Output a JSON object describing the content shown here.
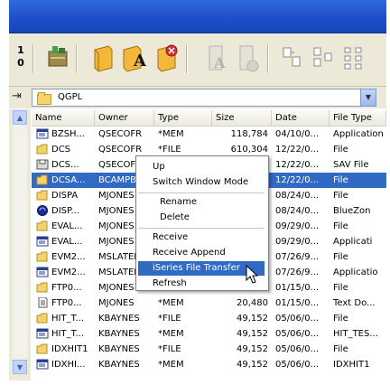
{
  "toolbar": {
    "left_number_top": "1",
    "left_number_bottom": "0"
  },
  "address": {
    "library": "QGPL"
  },
  "columns": [
    "Name",
    "Owner",
    "Type",
    "Size",
    "Date",
    "File Type"
  ],
  "rows": [
    {
      "icon": "member-icon",
      "name": "BZSH...",
      "owner": "QSECOFR",
      "type": "*MEM",
      "size": "118,784",
      "date": "04/10/0...",
      "filetype": "Application"
    },
    {
      "icon": "folder-icon",
      "name": "DCS",
      "owner": "QSECOFR",
      "type": "*FILE",
      "size": "610,304",
      "date": "12/22/0...",
      "filetype": "File"
    },
    {
      "icon": "save-file-icon",
      "name": "DCS...",
      "owner": "QSECOFR",
      "type": "",
      "size": "",
      "date": "12/22/0...",
      "filetype": "SAV File"
    },
    {
      "icon": "folder-icon",
      "name": "DCSA...",
      "owner": "BCAMPB",
      "type": "",
      "size": "",
      "date": "12/22/0...",
      "filetype": "File"
    },
    {
      "icon": "folder-icon",
      "name": "DISPA",
      "owner": "MJONES",
      "type": "",
      "size": "",
      "date": "08/24/0...",
      "filetype": "File"
    },
    {
      "icon": "bluezone-icon",
      "name": "DISP...",
      "owner": "MJONES",
      "type": "",
      "size": "",
      "date": "08/24/0...",
      "filetype": "BlueZon"
    },
    {
      "icon": "folder-icon",
      "name": "EVAL...",
      "owner": "MJONES",
      "type": "",
      "size": "",
      "date": "09/29/0...",
      "filetype": "File"
    },
    {
      "icon": "member-icon",
      "name": "EVAL...",
      "owner": "MJONES",
      "type": "",
      "size": "",
      "date": "09/29/0...",
      "filetype": "Applicati"
    },
    {
      "icon": "folder-icon",
      "name": "EVM2...",
      "owner": "MSLATER",
      "type": "",
      "size": "",
      "date": "07/26/9...",
      "filetype": "File"
    },
    {
      "icon": "member-icon",
      "name": "EVM2...",
      "owner": "MSLATER",
      "type": "",
      "size": "",
      "date": "07/26/9...",
      "filetype": "Applicatio"
    },
    {
      "icon": "folder-icon",
      "name": "FTP0...",
      "owner": "MJONES",
      "type": "",
      "size": "",
      "date": "01/15/0...",
      "filetype": "File"
    },
    {
      "icon": "text-file-icon",
      "name": "FTP0...",
      "owner": "MJONES",
      "type": "*MEM",
      "size": "20,480",
      "date": "01/15/0...",
      "filetype": "Text Do..."
    },
    {
      "icon": "folder-icon",
      "name": "HIT_T...",
      "owner": "KBAYNES",
      "type": "*FILE",
      "size": "49,152",
      "date": "05/06/0...",
      "filetype": "File"
    },
    {
      "icon": "member-icon",
      "name": "HIT_T...",
      "owner": "KBAYNES",
      "type": "*MEM",
      "size": "49,152",
      "date": "05/06/0...",
      "filetype": "HIT_TES..."
    },
    {
      "icon": "folder-icon",
      "name": "IDXHIT1",
      "owner": "KBAYNES",
      "type": "*FILE",
      "size": "49,152",
      "date": "05/06/0...",
      "filetype": "File"
    },
    {
      "icon": "member-icon",
      "name": "IDXHI...",
      "owner": "KBAYNES",
      "type": "*MEM",
      "size": "49,152",
      "date": "05/06/0...",
      "filetype": "IDXHIT1"
    }
  ],
  "selected_row": 3,
  "context_menu": {
    "items": [
      {
        "label": "Up",
        "indent": false
      },
      {
        "label": "Switch Window Mode",
        "indent": false
      },
      {
        "label": "Rename",
        "indent": true
      },
      {
        "label": "Delete",
        "indent": true
      },
      {
        "label": "Receive",
        "indent": false
      },
      {
        "label": "Receive Append",
        "indent": false
      },
      {
        "label": "iSeries File Transfer",
        "indent": false,
        "highlighted": true
      },
      {
        "label": "Refresh",
        "indent": false
      }
    ]
  },
  "colors": {
    "selection": "#316ac5",
    "titlebar": "#1e4fc9",
    "chrome": "#ece9d8"
  }
}
